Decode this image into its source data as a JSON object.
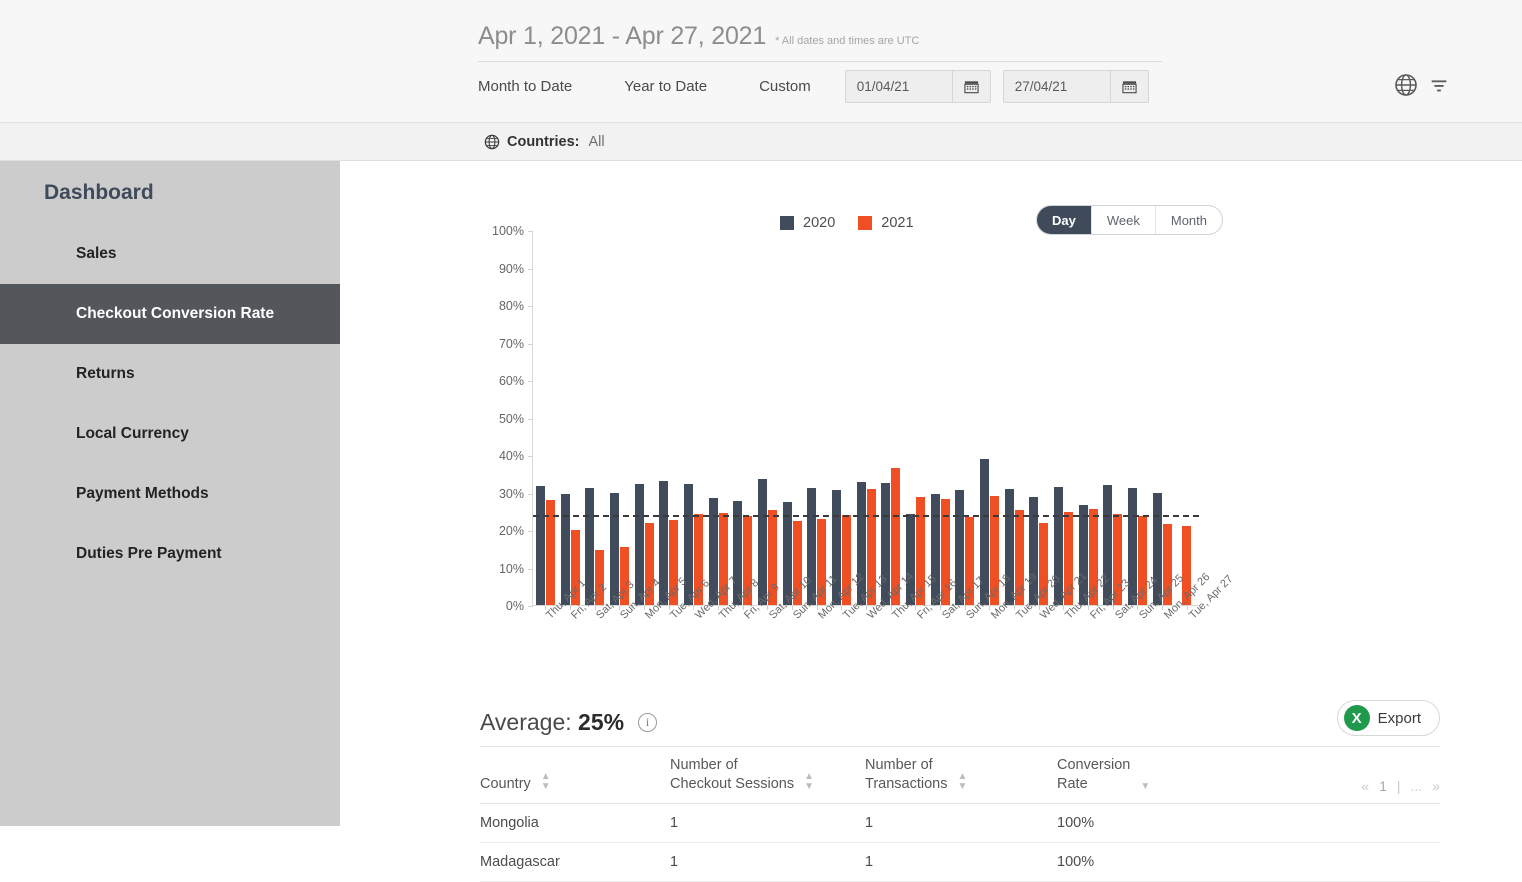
{
  "header": {
    "date_range_title": "Apr 1, 2021 - Apr 27, 2021",
    "utc_note": "* All dates and times are UTC",
    "tabs": [
      {
        "label": "Month to Date"
      },
      {
        "label": "Year to Date"
      },
      {
        "label": "Custom"
      }
    ],
    "date_from": "01/04/21",
    "date_to": "27/04/21",
    "icons": {
      "globe": "globe-icon",
      "filter": "filter-icon",
      "calendar": "calendar-icon"
    }
  },
  "filter_bar": {
    "icon": "globe-icon",
    "label": "Countries:",
    "value": "All"
  },
  "sidebar": {
    "title": "Dashboard",
    "items": [
      {
        "label": "Sales",
        "active": false
      },
      {
        "label": "Checkout Conversion Rate",
        "active": true
      },
      {
        "label": "Returns",
        "active": false
      },
      {
        "label": "Local Currency",
        "active": false
      },
      {
        "label": "Payment Methods",
        "active": false
      },
      {
        "label": "Duties Pre Payment",
        "active": false
      }
    ]
  },
  "granularity": {
    "options": [
      {
        "label": "Day",
        "active": true
      },
      {
        "label": "Week",
        "active": false
      },
      {
        "label": "Month",
        "active": false
      }
    ]
  },
  "summary": {
    "average_prefix": "Average:",
    "average_value": "25%",
    "info_glyph": "i",
    "export_label": "Export",
    "export_icon_letter": "X"
  },
  "table": {
    "columns": [
      {
        "label": "Country",
        "sortable": true,
        "sort": "none"
      },
      {
        "label": "Number of\nCheckout Sessions",
        "sortable": true,
        "sort": "none"
      },
      {
        "label": "Number of\nTransactions",
        "sortable": true,
        "sort": "none"
      },
      {
        "label": "Conversion\nRate",
        "sortable": true,
        "sort": "desc"
      }
    ],
    "col_labels": {
      "country": "Country",
      "sessions_l1": "Number of",
      "sessions_l2": "Checkout Sessions",
      "transactions_l1": "Number of",
      "transactions_l2": "Transactions",
      "rate_l1": "Conversion",
      "rate_l2": "Rate"
    },
    "pagination": {
      "first": "«",
      "page": "1",
      "divider": "|",
      "ellipsis": "...",
      "last": "»"
    },
    "rows": [
      {
        "country": "Mongolia",
        "sessions": "1",
        "transactions": "1",
        "rate": "100%"
      },
      {
        "country": "Madagascar",
        "sessions": "1",
        "transactions": "1",
        "rate": "100%"
      }
    ]
  },
  "chart_data": {
    "type": "bar",
    "title": "",
    "xlabel": "",
    "ylabel": "",
    "ylim": [
      0,
      100
    ],
    "ytick_labels": [
      "100%",
      "90%",
      "80%",
      "70%",
      "60%",
      "50%",
      "40%",
      "30%",
      "20%",
      "10%",
      "0%"
    ],
    "grid": false,
    "legend_position": "top-center",
    "average_line": 23.5,
    "average_label": "25%",
    "categories": [
      "Thu, Apr 1",
      "Fri, Apr 2",
      "Sat, Apr 3",
      "Sun, Apr 4",
      "Mon, Apr 5",
      "Tue, Apr 6",
      "Wed, Apr 7",
      "Thu, Apr 8",
      "Fri, Apr 9",
      "Sat, Apr 10",
      "Sun, Apr 11",
      "Mon, Apr 12",
      "Tue, Apr 13",
      "Wed, Apr 14",
      "Thu, Apr 15",
      "Fri, Apr 16",
      "Sat, Apr 17",
      "Sun, Apr 18",
      "Mon, Apr 19",
      "Tue, Apr 20",
      "Wed, Apr 21",
      "Thu, Apr 22",
      "Fri, Apr 23",
      "Sat, Apr 24",
      "Sun, Apr 25",
      "Mon, Apr 26",
      "Tue, Apr 27"
    ],
    "series": [
      {
        "name": "2020",
        "color": "#404b5c",
        "values": [
          31.8,
          29.6,
          31.2,
          29.9,
          32.3,
          33.2,
          32.2,
          28.5,
          27.7,
          33.6,
          27.4,
          31.3,
          30.8,
          32.8,
          32.5,
          24.4,
          29.5,
          30.6,
          39.0,
          31.0,
          28.9,
          31.4,
          26.7,
          32.0,
          31.1,
          29.9,
          0
        ]
      },
      {
        "name": "2021",
        "color": "#f04f23",
        "values": [
          28.0,
          20.0,
          14.8,
          15.5,
          21.9,
          22.6,
          24.4,
          24.5,
          23.8,
          25.4,
          22.4,
          23.0,
          24.0,
          30.9,
          36.6,
          28.8,
          28.4,
          23.5,
          29.0,
          25.3,
          21.9,
          24.8,
          25.6,
          24.2,
          23.7,
          21.7,
          21.2
        ]
      }
    ]
  }
}
